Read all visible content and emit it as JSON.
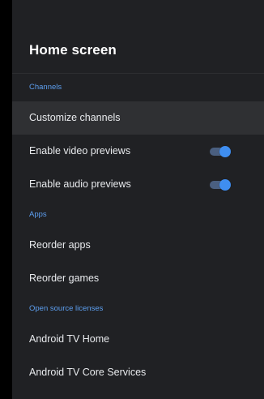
{
  "header": {
    "title": "Home screen"
  },
  "sections": [
    {
      "label": "Channels",
      "items": [
        {
          "label": "Customize channels"
        },
        {
          "label": "Enable video previews",
          "toggle_on": true
        },
        {
          "label": "Enable audio previews",
          "toggle_on": true
        }
      ]
    },
    {
      "label": "Apps",
      "items": [
        {
          "label": "Reorder apps"
        },
        {
          "label": "Reorder games"
        }
      ]
    },
    {
      "label": "Open source licenses",
      "items": [
        {
          "label": "Android TV Home"
        },
        {
          "label": "Android TV Core Services"
        }
      ]
    }
  ],
  "colors": {
    "accent": "#3f8ef0",
    "section_label": "#5d9ff0",
    "panel_bg": "#202124",
    "focused_row_bg": "#2f3033"
  }
}
